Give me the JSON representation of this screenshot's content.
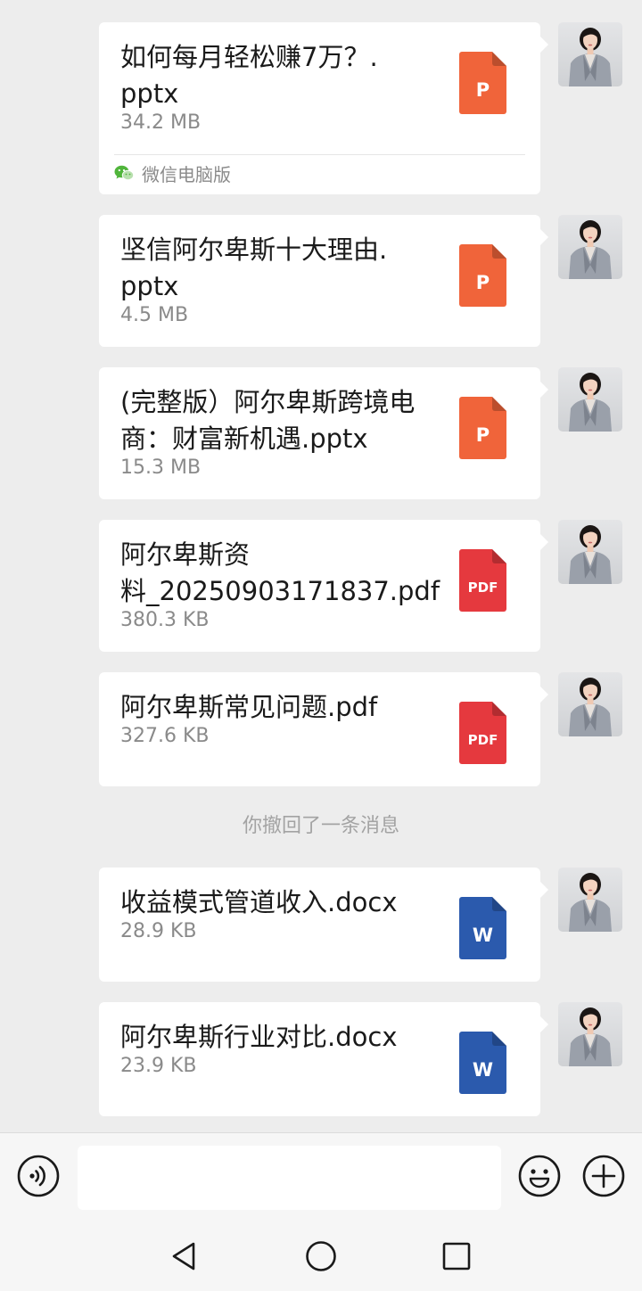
{
  "messages": [
    {
      "name": "如何每月轻松赚7万？.pptx",
      "lines": [
        "如何每月轻松赚7万？.",
        "pptx"
      ],
      "size": "34.2 MB",
      "type": "pptx",
      "icon_letter": "P",
      "source": "微信电脑版"
    },
    {
      "name": "坚信阿尔卑斯十大理由.pptx",
      "lines": [
        "坚信阿尔卑斯十大理由.",
        "pptx"
      ],
      "size": "4.5 MB",
      "type": "pptx",
      "icon_letter": "P"
    },
    {
      "name": "(完整版）阿尔卑斯跨境电商：财富新机遇.pptx",
      "lines": [
        "(完整版）阿尔卑斯跨境电",
        "商：财富新机遇.pptx"
      ],
      "size": "15.3 MB",
      "type": "pptx",
      "icon_letter": "P"
    },
    {
      "name": "阿尔卑斯资料_20250903171837.pdf",
      "lines": [
        "阿尔卑斯资",
        "料_20250903171837.pdf"
      ],
      "size": "380.3 KB",
      "type": "pdf",
      "icon_letter": "PDF"
    },
    {
      "name": "阿尔卑斯常见问题.pdf",
      "lines": [
        "阿尔卑斯常见问题.pdf"
      ],
      "size": "327.6 KB",
      "type": "pdf",
      "icon_letter": "PDF"
    },
    {
      "name": "收益模式管道收入.docx",
      "lines": [
        "收益模式管道收入.docx"
      ],
      "size": "28.9 KB",
      "type": "docx",
      "icon_letter": "W"
    },
    {
      "name": "阿尔卑斯行业对比.docx",
      "lines": [
        "阿尔卑斯行业对比.docx"
      ],
      "size": "23.9 KB",
      "type": "docx",
      "icon_letter": "W"
    }
  ],
  "system_notice": "你撤回了一条消息",
  "icon_colors": {
    "pptx": "#f0643a",
    "pdf": "#e5393e",
    "docx": "#2b5aad"
  },
  "icons": {
    "input_bar": [
      "voice-icon",
      "emoji-icon",
      "plus-icon"
    ],
    "nav_bar": [
      "back-triangle-icon",
      "home-circle-icon",
      "recents-square-icon"
    ]
  },
  "input_value": ""
}
